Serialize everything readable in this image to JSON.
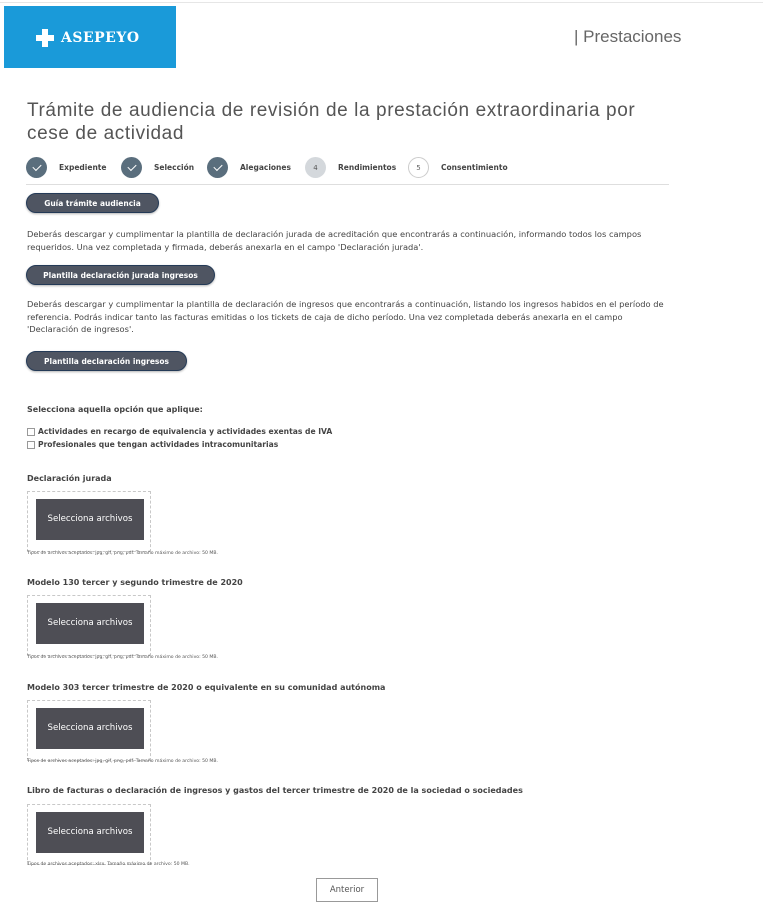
{
  "header": {
    "brand": "ASEPEYO",
    "section": "| Prestaciones"
  },
  "page": {
    "title": "Trámite de audiencia de revisión de la prestación extraordinaria por cese de actividad"
  },
  "steps": [
    {
      "number": "",
      "label": "Expediente",
      "state": "done"
    },
    {
      "number": "",
      "label": "Selección",
      "state": "done"
    },
    {
      "number": "",
      "label": "Alegaciones",
      "state": "done"
    },
    {
      "number": "4",
      "label": "Rendimientos",
      "state": "active"
    },
    {
      "number": "5",
      "label": "Consentimiento",
      "state": "pending"
    }
  ],
  "buttons": {
    "guia": "Guía trámite audiencia",
    "plantilla_jurada": "Plantilla declaración jurada ingresos",
    "plantilla_ingresos": "Plantilla declaración ingresos",
    "anterior": "Anterior"
  },
  "paragraphs": {
    "p1": "Deberás descargar y cumplimentar la plantilla de declaración jurada de acreditación que encontrarás a continuación, informando todos los campos requeridos. Una vez completada y firmada, deberás anexarla en el campo 'Declaración jurada'.",
    "p2": "Deberás descargar y cumplimentar la plantilla de declaración de ingresos que encontrarás a continuación, listando los ingresos habidos en el período de referencia. Podrás indicar tanto las facturas emitidas o los tickets de caja de dicho período. Una vez completada deberás anexarla en el campo 'Declaración de ingresos'."
  },
  "options": {
    "label": "Selecciona aquella opción que aplique:",
    "items": [
      "Actividades en recargo de equivalencia y actividades exentas de IVA",
      "Profesionales que tengan actividades intracomunitarias"
    ]
  },
  "uploads": [
    {
      "label": "Declaración jurada",
      "button": "Selecciona archivos",
      "hint": "Tipos de archivos aceptados: jpg, gif, png, pdf. Tamaño máximo de archivo: 50 MB."
    },
    {
      "label": "Modelo 130 tercer y segundo trimestre de 2020",
      "button": "Selecciona archivos",
      "hint": "Tipos de archivos aceptados: jpg, gif, png, pdf. Tamaño máximo de archivo: 50 MB."
    },
    {
      "label": "Modelo 303 tercer trimestre de 2020 o equivalente en su comunidad autónoma",
      "button": "Selecciona archivos",
      "hint": "Tipos de archivos aceptados: jpg, gif, png, pdf. Tamaño máximo de archivo: 50 MB."
    },
    {
      "label": "Libro de facturas o declaración de ingresos y gastos del tercer trimestre de 2020 de la sociedad o sociedades",
      "button": "Selecciona archivos",
      "hint": "Tipos de archivos aceptados: xlsx. Tamaño máximo de archivo: 50 MB."
    }
  ],
  "colors": {
    "brand": "#1a9ad9",
    "step_done": "#5a6e7d",
    "pill": "#4f5562",
    "upload_button": "#4e4e55"
  }
}
